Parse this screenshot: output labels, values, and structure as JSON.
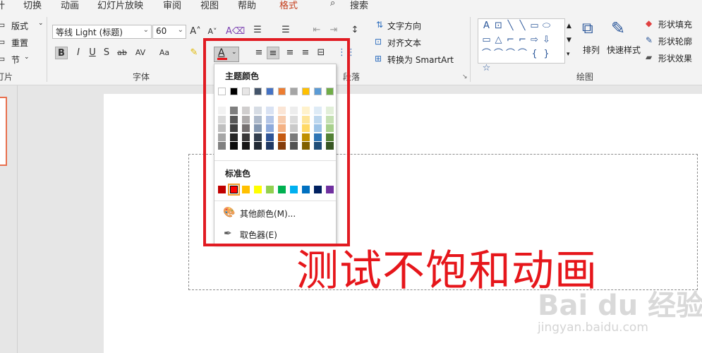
{
  "tabs": [
    {
      "label": "计"
    },
    {
      "label": "切换"
    },
    {
      "label": "动画"
    },
    {
      "label": "幻灯片放映"
    },
    {
      "label": "审阅"
    },
    {
      "label": "视图"
    },
    {
      "label": "帮助"
    },
    {
      "label": "格式"
    }
  ],
  "search": {
    "label": "搜索"
  },
  "slides_group": {
    "layout": "版式",
    "reset": "重置",
    "section": "节",
    "label": "灯片"
  },
  "font_group": {
    "font_name": "等线 Light (标题)",
    "font_size": "60",
    "label": "字体",
    "bold": "B",
    "italic": "I",
    "underline": "U",
    "shadow": "S",
    "strike": "ab",
    "spacing": "AV",
    "case": "Aa",
    "font_color": "A"
  },
  "paragraph_group": {
    "label": "段落",
    "text_direction": "文字方向",
    "align_text": "对齐文本",
    "smartart": "转换为 SmartArt"
  },
  "drawing_group": {
    "label": "绘图",
    "arrange": "排列",
    "quick_styles": "快速样式",
    "shape_fill": "形状填充",
    "shape_outline": "形状轮廓",
    "shape_effects": "形状效果"
  },
  "shapes_gallery": {
    "glyphs": [
      "A",
      "⊡",
      "╲",
      "╲",
      "▭",
      "⬭",
      "▭",
      "△",
      "⌐",
      "⌐",
      "⇨",
      "⇩",
      "⌒",
      "⌒",
      "⌒",
      "⌒",
      "{",
      "}",
      "☆"
    ]
  },
  "slide": {
    "text": "测试不饱和动画"
  },
  "dropdown": {
    "theme_header": "主题颜色",
    "standard_header": "标准色",
    "more_colors": "其他颜色(M)...",
    "eyedropper": "取色器(E)",
    "theme_top": [
      "#ffffff",
      "#000000",
      "#e7e6e6",
      "#44546a",
      "#4472c4",
      "#ed7d31",
      "#a5a5a5",
      "#ffc000",
      "#5b9bd5",
      "#70ad47"
    ],
    "theme_shades": [
      [
        "#f2f2f2",
        "#d9d9d9",
        "#bfbfbf",
        "#a6a6a6",
        "#808080"
      ],
      [
        "#7f7f7f",
        "#595959",
        "#404040",
        "#262626",
        "#0d0d0d"
      ],
      [
        "#d0cece",
        "#aeabab",
        "#757070",
        "#3a3838",
        "#171616"
      ],
      [
        "#d6dce4",
        "#adb9ca",
        "#8497b0",
        "#333f4f",
        "#222a35"
      ],
      [
        "#d9e2f3",
        "#b4c6e7",
        "#8eaadb",
        "#2f5496",
        "#1f3864"
      ],
      [
        "#fbe5d5",
        "#f7cbac",
        "#f4b183",
        "#c55a11",
        "#843c0b"
      ],
      [
        "#ededed",
        "#dbdbdb",
        "#c9c9c9",
        "#7b7b7b",
        "#525252"
      ],
      [
        "#fff2cc",
        "#fee599",
        "#ffd965",
        "#bf9000",
        "#7f6000"
      ],
      [
        "#deebf6",
        "#bdd7ee",
        "#9dc3e6",
        "#2e75b5",
        "#1f4e79"
      ],
      [
        "#e2efd9",
        "#c5e0b3",
        "#a8d08d",
        "#538135",
        "#375623"
      ]
    ],
    "standard": [
      "#c00000",
      "#ff0000",
      "#ffc000",
      "#ffff00",
      "#92d050",
      "#00b050",
      "#00b0f0",
      "#0070c0",
      "#002060",
      "#7030a0"
    ],
    "selected_standard_index": 1
  },
  "watermark": {
    "brand": "Bai du 经验",
    "url": "jingyan.baidu.com"
  }
}
